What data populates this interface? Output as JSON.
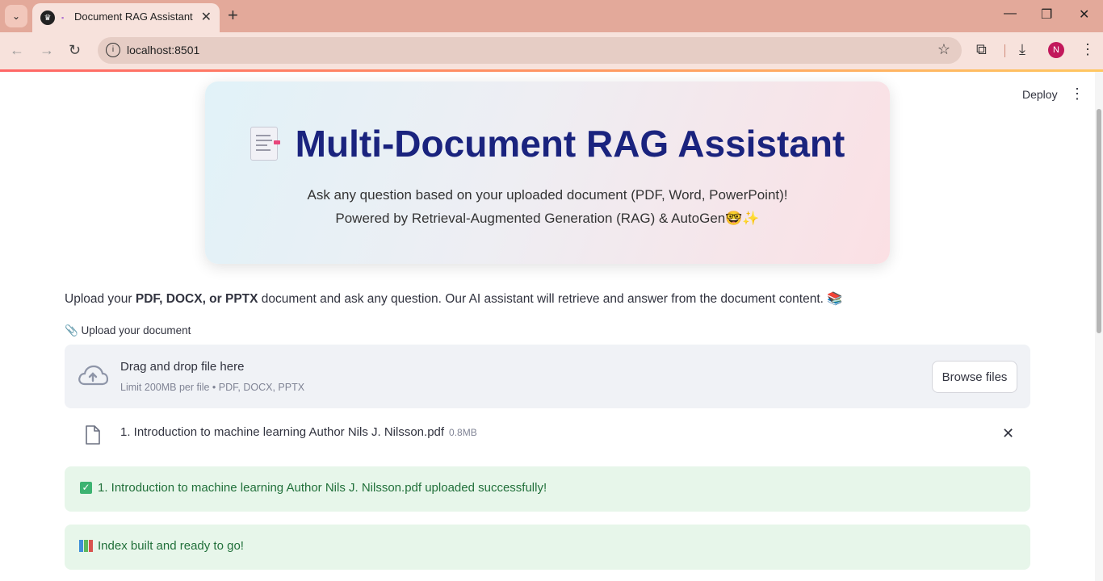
{
  "browser": {
    "tab_title": "Document RAG Assistant",
    "url": "localhost:8501",
    "profile_initial": "N"
  },
  "app": {
    "deploy_label": "Deploy",
    "hero": {
      "title": "Multi-Document RAG Assistant",
      "subtitle_line1": "Ask any question based on your uploaded document (PDF, Word, PowerPoint)!",
      "subtitle_line2": "Powered by Retrieval-Augmented Generation (RAG) & AutoGen🤓✨"
    },
    "intro": {
      "prefix": "Upload your ",
      "bold": "PDF, DOCX, or PPTX",
      "suffix": " document and ask any question. Our AI assistant will retrieve and answer from the document content. 📚"
    },
    "uploader": {
      "label": "📎 Upload your document",
      "drag_text": "Drag and drop file here",
      "limit_text": "Limit 200MB per file • PDF, DOCX, PPTX",
      "browse_label": "Browse files"
    },
    "uploaded_file": {
      "name": "1. Introduction to machine learning Author Nils J. Nilsson.pdf",
      "size": "0.8MB"
    },
    "alerts": [
      {
        "text": "1. Introduction to machine learning Author Nils J. Nilsson.pdf uploaded successfully!"
      },
      {
        "text": "Index built and ready to go!"
      }
    ]
  },
  "colors": {
    "hero_title": "#1a237e",
    "success_bg": "#e7f6ea",
    "success_text": "#21703a",
    "tabbar_bg": "#e3a99a"
  }
}
